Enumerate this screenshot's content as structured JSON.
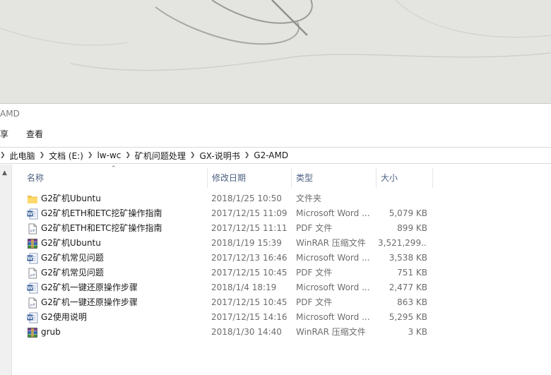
{
  "window": {
    "title": "AMD",
    "ribbon_tabs": [
      "享",
      "查看"
    ],
    "breadcrumb": [
      "此电脑",
      "文档 (E:)",
      "lw-wc",
      "矿机问题处理",
      "GX-说明书",
      "G2-AMD"
    ]
  },
  "columns": {
    "name": "名称",
    "date": "修改日期",
    "type": "类型",
    "size": "大小"
  },
  "files": [
    {
      "icon": "folder-icon",
      "name": "G2矿机Ubuntu",
      "date": "2018/1/25 10:50",
      "type": "文件夹",
      "size": ""
    },
    {
      "icon": "word-doc-icon",
      "name": "G2矿机ETH和ETC挖矿操作指南",
      "date": "2017/12/15 11:09",
      "type": "Microsoft Word ...",
      "size": "5,079 KB"
    },
    {
      "icon": "pdf-icon",
      "name": "G2矿机ETH和ETC挖矿操作指南",
      "date": "2017/12/15 11:11",
      "type": "PDF 文件",
      "size": "899 KB"
    },
    {
      "icon": "winrar-icon",
      "name": "G2矿机Ubuntu",
      "date": "2018/1/19 15:39",
      "type": "WinRAR 压缩文件",
      "size": "3,521,299..."
    },
    {
      "icon": "word-doc-icon",
      "name": "G2矿机常见问题",
      "date": "2017/12/13 16:46",
      "type": "Microsoft Word ...",
      "size": "3,538 KB"
    },
    {
      "icon": "pdf-icon",
      "name": "G2矿机常见问题",
      "date": "2017/12/15 10:45",
      "type": "PDF 文件",
      "size": "751 KB"
    },
    {
      "icon": "word-doc-icon",
      "name": "G2矿机一键还原操作步骤",
      "date": "2018/1/4 18:19",
      "type": "Microsoft Word ...",
      "size": "2,477 KB"
    },
    {
      "icon": "pdf-icon",
      "name": "G2矿机一键还原操作步骤",
      "date": "2017/12/15 10:45",
      "type": "PDF 文件",
      "size": "863 KB"
    },
    {
      "icon": "word-doc-icon",
      "name": "G2使用说明",
      "date": "2017/12/15 14:16",
      "type": "Microsoft Word ...",
      "size": "5,295 KB"
    },
    {
      "icon": "winrar-icon",
      "name": "grub",
      "date": "2018/1/30 14:40",
      "type": "WinRAR 压缩文件",
      "size": "3 KB"
    }
  ]
}
